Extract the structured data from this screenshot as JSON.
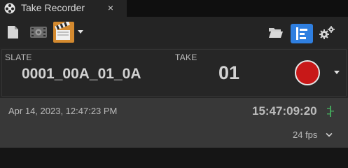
{
  "tab": {
    "title": "Take Recorder",
    "close_label": "×"
  },
  "toolbar": {
    "icons": [
      "new-document-icon",
      "sequence-film-icon",
      "clapperboard-icon",
      "folder-open-icon",
      "take-list-icon",
      "settings-gears-icon"
    ],
    "accent_color": "#e8a33c",
    "active_color": "#2f7fe0"
  },
  "slate": {
    "label": "SLATE",
    "value": "0001_00A_01_0A"
  },
  "take": {
    "label": "TAKE",
    "value": "01"
  },
  "record": {
    "color": "#c81818"
  },
  "info": {
    "date": "Apr 14, 2023, 12:47:23 PM",
    "timecode": "15:47:09:20",
    "fps": "24 fps"
  }
}
